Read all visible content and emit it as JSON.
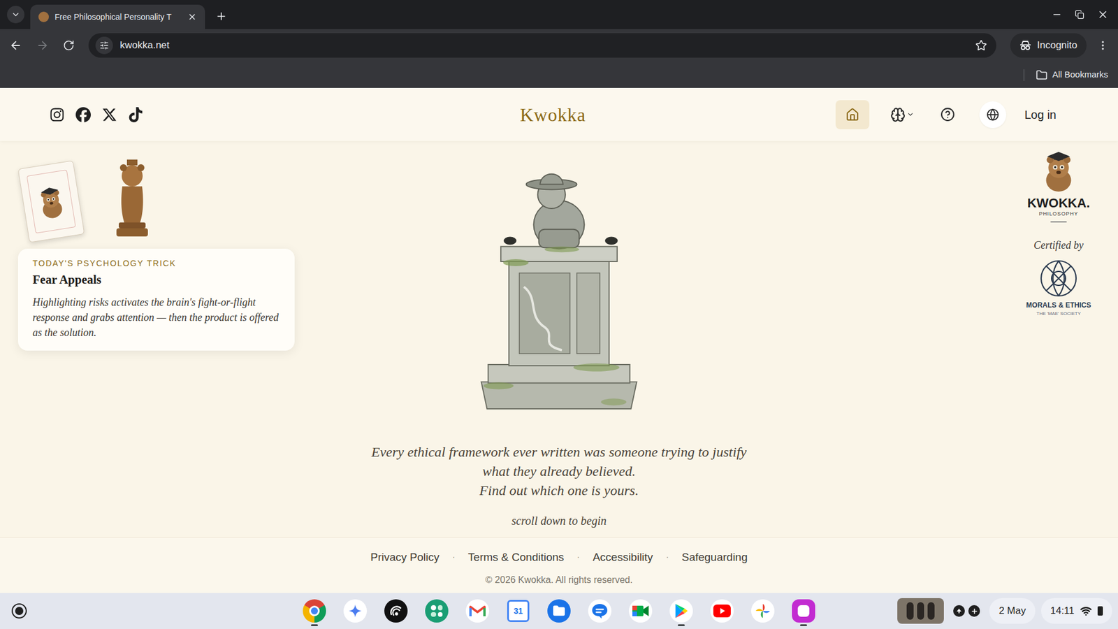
{
  "browser": {
    "tab": {
      "title": "Free Philosophical Personality T"
    },
    "url": "kwokka.net",
    "forward_disabled": true,
    "incognito": "Incognito",
    "bookmarks": "All Bookmarks"
  },
  "header": {
    "title": "Kwokka",
    "socials": [
      {
        "kind": "instagram"
      },
      {
        "kind": "facebook"
      },
      {
        "kind": "x"
      },
      {
        "kind": "tiktok"
      }
    ],
    "nav": [
      {
        "kind": "home",
        "selected": true
      },
      {
        "kind": "philosophy",
        "selected": false
      },
      {
        "kind": "help",
        "selected": false
      },
      {
        "kind": "language",
        "selected": false
      }
    ],
    "login": "Log in"
  },
  "trick": {
    "label": "TODAY'S PSYCHOLOGY TRICK",
    "title": "Fear Appeals",
    "body": "Highlighting risks activates the brain's fight-or-flight response and grabs attention — then the product is offered as the solution."
  },
  "tagline": [
    "Every ethical framework ever written was someone trying to justify",
    "what they already believed.",
    "Find out which one is yours."
  ],
  "scroll_hint": "scroll down to begin",
  "badge": {
    "brand": "KWOKKA.",
    "subtitle": "PHILOSOPHY",
    "certified": "Certified by",
    "society": "MORALS & ETHICS",
    "society_sub": "THE 'MAE' SOCIETY"
  },
  "footer": {
    "links": [
      "Privacy Policy",
      "Terms & Conditions",
      "Accessibility",
      "Safeguarding"
    ],
    "separator": "·",
    "copyright": "© 2026 Kwokka. All rights reserved."
  },
  "shelf": {
    "apps": [
      {
        "kind": "chrome",
        "open": true
      },
      {
        "kind": "gemini",
        "open": false
      },
      {
        "kind": "podcast",
        "open": false
      },
      {
        "kind": "apps",
        "open": false
      },
      {
        "kind": "gmail",
        "open": false
      },
      {
        "kind": "calendar",
        "open": false,
        "label": "31"
      },
      {
        "kind": "files",
        "open": false
      },
      {
        "kind": "messages",
        "open": false
      },
      {
        "kind": "meet",
        "open": false
      },
      {
        "kind": "play",
        "open": true
      },
      {
        "kind": "youtube",
        "open": false
      },
      {
        "kind": "photos",
        "open": false
      },
      {
        "kind": "canvas",
        "open": true
      }
    ],
    "date": "2 May",
    "time": "14:11"
  }
}
